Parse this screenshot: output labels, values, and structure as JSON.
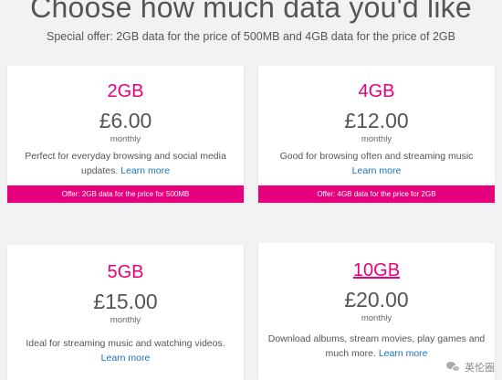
{
  "header": {
    "title": "Choose how much data you'd like",
    "subtitle": "Special offer: 2GB data for the price of 500MB and 4GB data for the price of 2GB"
  },
  "plans": [
    {
      "name": "2GB",
      "price": "£6.00",
      "period": "monthly",
      "description": "Perfect for everyday browsing and social media updates.",
      "learn_more": "Learn more",
      "offer": "Offer: 2GB data for the price for 500MB"
    },
    {
      "name": "4GB",
      "price": "£12.00",
      "period": "monthly",
      "description": "Good for browsing often and streaming music",
      "learn_more": "Learn more",
      "offer": "Offer: 4GB data for the price for 2GB"
    },
    {
      "name": "5GB",
      "price": "£15.00",
      "period": "monthly",
      "description": "Ideal for streaming music and watching videos.",
      "learn_more": "Learn more"
    },
    {
      "name": "10GB",
      "price": "£20.00",
      "period": "monthly",
      "description": "Download albums, stream movies, play games and much more.",
      "learn_more": "Learn more"
    }
  ],
  "watermark": {
    "text": "英伦圈",
    "icon": "wechat-icon"
  },
  "colors": {
    "accent": "#e6007e",
    "link": "#1a73b8",
    "background": "#f2f2f4"
  }
}
